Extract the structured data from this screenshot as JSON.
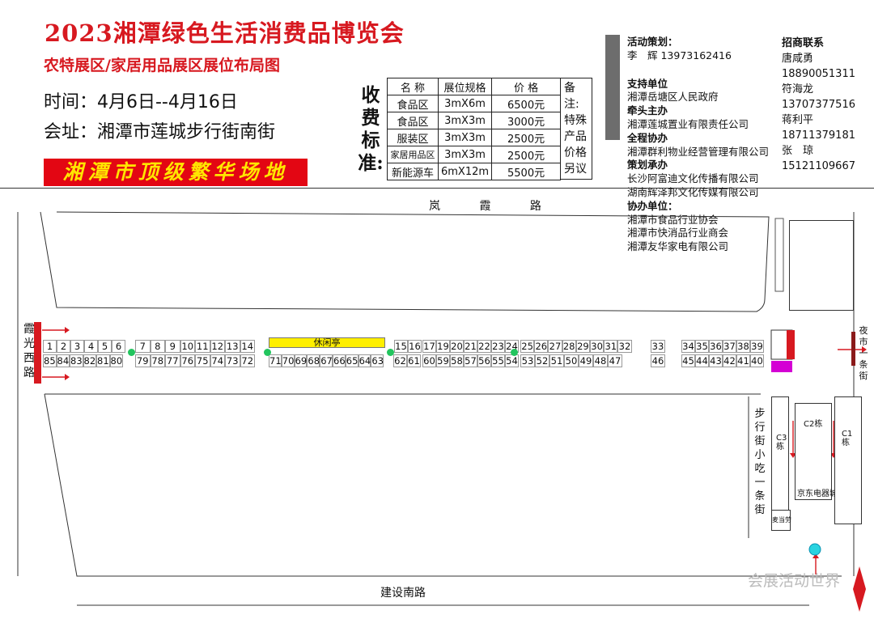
{
  "header": {
    "title": "2023湘潭绿色生活消费品博览会",
    "subtitle": "农特展区/家居用品展区展位布局图",
    "time": "时间：4月6日--4月16日",
    "venue": "会址：湘潭市莲城步行街南街",
    "banner": "湘潭市顶级繁华场地"
  },
  "fees": {
    "label": "收费标准:",
    "headers": [
      "名 称",
      "展位规格",
      "价 格"
    ],
    "rows": [
      [
        "食品区",
        "3mX6m",
        "6500元"
      ],
      [
        "食品区",
        "3mX3m",
        "3000元"
      ],
      [
        "服装区",
        "3mX3m",
        "2500元"
      ],
      [
        "家居用品区",
        "3mX3m",
        "2500元"
      ],
      [
        "新能源车",
        "6mX12m",
        "5500元"
      ]
    ],
    "note": "备注:特殊产品价格另议"
  },
  "sponsors": [
    {
      "h": "活动策划：",
      "lines": [
        "李　辉 13973162416"
      ]
    },
    {
      "h": "支持单位",
      "lines": [
        "湘潭岳塘区人民政府"
      ]
    },
    {
      "h": "牵头主办",
      "lines": [
        "湘潭莲城置业有限责任公司"
      ]
    },
    {
      "h": "全程协办",
      "lines": [
        "湘潭群利物业经营管理有限公司"
      ]
    },
    {
      "h": "策划承办",
      "lines": [
        "长沙阿富迪文化传播有限公司",
        "湖南辉泽邦文化传媒有限公司"
      ]
    },
    {
      "h": "协办单位：",
      "lines": [
        "湘潭市食品行业协会",
        "湘潭市快消品行业商会",
        "湘潭友华家电有限公司"
      ]
    }
  ],
  "contacts": {
    "h": "招商联系",
    "people": [
      {
        "name": "唐咸勇",
        "phone": "18890051311"
      },
      {
        "name": "符海龙",
        "phone": "13707377516"
      },
      {
        "name": "蒋利平",
        "phone": "18711379181"
      },
      {
        "name": "张　琼",
        "phone": "15121109667"
      }
    ]
  },
  "map": {
    "road_top": "岚 霞 路",
    "road_bottom": "建设南路",
    "road_left": "霞光西路",
    "road_right": "夜市一条街",
    "snack_street": "步行街小吃一条街",
    "rest_area": "休闲亭",
    "jd": "京东电器城",
    "mcd": "麦当劳",
    "bldg_c2": "C2栋",
    "bldg_c3": "C3栋",
    "bldg_c1": "C1栋",
    "top_row": [
      "1",
      "2",
      "3",
      "4",
      "5",
      "6",
      "7",
      "8",
      "9",
      "10",
      "11",
      "12",
      "13",
      "14",
      "15",
      "16",
      "17",
      "19",
      "20",
      "21",
      "22",
      "23",
      "24",
      "25",
      "26",
      "27",
      "28",
      "29",
      "30",
      "31",
      "32",
      "33",
      "34",
      "35",
      "36",
      "37",
      "38",
      "39"
    ],
    "bottom_row": [
      "85",
      "84",
      "83",
      "82",
      "81",
      "80",
      "79",
      "78",
      "77",
      "76",
      "75",
      "74",
      "73",
      "72",
      "71",
      "70",
      "69",
      "68",
      "67",
      "66",
      "65",
      "64",
      "63",
      "62",
      "61",
      "60",
      "59",
      "58",
      "57",
      "56",
      "55",
      "54",
      "53",
      "52",
      "51",
      "50",
      "49",
      "48",
      "47",
      "46",
      "45",
      "44",
      "43",
      "42",
      "41",
      "40"
    ]
  },
  "watermark": "会展活动世界",
  "colors": {
    "title": "#d71920",
    "banner_bg": "#e30613",
    "banner_text": "#ffe600",
    "rest_area": "#ffef00",
    "dot": "#22c55e"
  }
}
